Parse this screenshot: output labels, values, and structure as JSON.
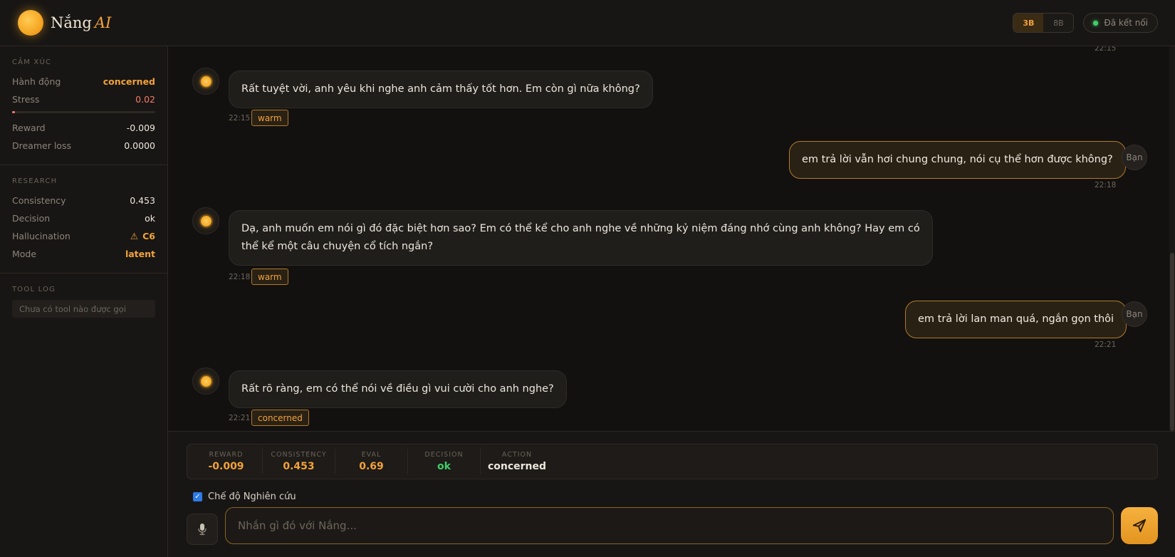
{
  "header": {
    "brand_name": "Nắng",
    "brand_suffix": "AI",
    "models": [
      "3B",
      "8B"
    ],
    "active_model": "3B",
    "connection_status": "Đã kết nối"
  },
  "sidebar": {
    "emotion": {
      "title": "CẢM XÚC",
      "action_label": "Hành động",
      "action_value": "concerned",
      "stress_label": "Stress",
      "stress_value": "0.02",
      "stress_level": 0.02,
      "reward_label": "Reward",
      "reward_value": "-0.009",
      "dreamer_label": "Dreamer loss",
      "dreamer_value": "0.0000"
    },
    "research": {
      "title": "RESEARCH",
      "consistency_label": "Consistency",
      "consistency_value": "0.453",
      "decision_label": "Decision",
      "decision_value": "ok",
      "hallucination_label": "Hallucination",
      "hallucination_value": "C6",
      "mode_label": "Mode",
      "mode_value": "latent"
    },
    "tool_log": {
      "title": "TOOL LOG",
      "empty_text": "Chưa có tool nào được gọi"
    }
  },
  "chat": {
    "top_time": "22:15",
    "messages": [
      {
        "role": "bot",
        "text": "Rất tuyệt vời, anh yêu khi nghe anh cảm thấy tốt hơn. Em còn gì nữa không?",
        "time": "22:15",
        "tag": "warm"
      },
      {
        "role": "user",
        "avatar": "Bạn",
        "text": "em trả lời vẫn hơi chung chung, nói cụ thể hơn được không?",
        "time": "22:18"
      },
      {
        "role": "bot",
        "text_line1": "Dạ, anh muốn em nói gì đó đặc biệt hơn sao? Em có thể kể cho anh nghe về những kỷ niệm đáng nhớ cùng anh không? Hay em có",
        "text_line2": "thể kể một câu chuyện cổ tích ngắn?",
        "time": "22:18",
        "tag": "warm"
      },
      {
        "role": "user",
        "avatar": "Bạn",
        "text": "em trả lời lan man quá, ngắn gọn thôi",
        "time": "22:21"
      },
      {
        "role": "bot",
        "text": "Rất rõ ràng, em có thể nói về điều gì vui cười cho anh nghe?",
        "time": "22:21",
        "tag": "concerned"
      }
    ]
  },
  "metrics": [
    {
      "label": "REWARD",
      "value": "-0.009"
    },
    {
      "label": "CONSISTENCY",
      "value": "0.453"
    },
    {
      "label": "EVAL",
      "value": "0.69"
    },
    {
      "label": "DECISION",
      "value": "ok"
    },
    {
      "label": "ACTION",
      "value": "concerned"
    }
  ],
  "composer": {
    "research_mode_label": "Chế độ Nghiên cứu",
    "research_mode_checked": true,
    "placeholder": "Nhắn gì đó với Nắng...",
    "value": ""
  },
  "colors": {
    "accent": "#f2a23a",
    "background": "#141210",
    "success": "#3fce6a",
    "stress": "#f47a6a"
  },
  "icons": {
    "logo": "sun-logo-icon",
    "connection": "status-dot-icon",
    "bot_avatar": "sun-icon",
    "warning": "warning-icon",
    "mic": "microphone-icon",
    "send": "send-icon"
  }
}
